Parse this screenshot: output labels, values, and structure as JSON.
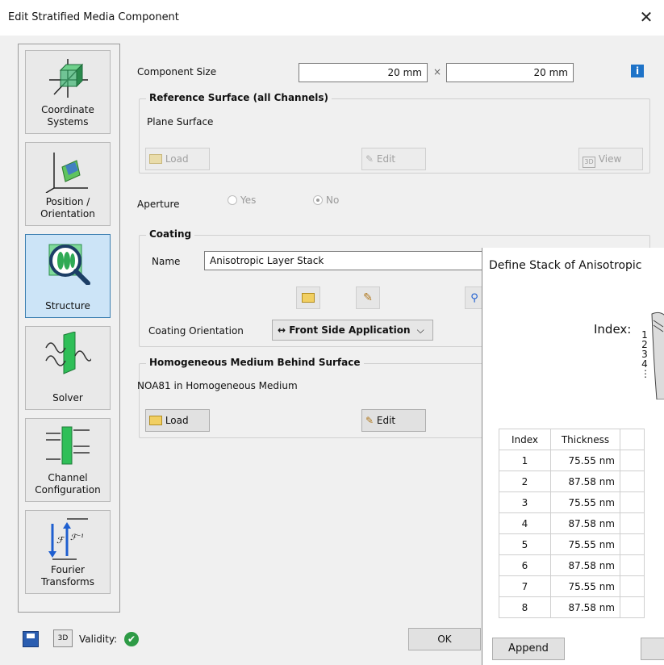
{
  "window": {
    "title": "Edit Stratified Media Component",
    "close_glyph": "✕"
  },
  "sidebar": {
    "items": [
      {
        "label_line1": "Coordinate",
        "label_line2": "Systems",
        "icon": "coordinate-systems-icon"
      },
      {
        "label_line1": "Position /",
        "label_line2": "Orientation",
        "icon": "position-orientation-icon"
      },
      {
        "label_line1": "Structure",
        "label_line2": "",
        "icon": "structure-icon",
        "selected": true
      },
      {
        "label_line1": "Solver",
        "label_line2": "",
        "icon": "solver-icon"
      },
      {
        "label_line1": "Channel",
        "label_line2": "Configuration",
        "icon": "channel-configuration-icon"
      },
      {
        "label_line1": "Fourier",
        "label_line2": "Transforms",
        "icon": "fourier-transforms-icon"
      }
    ]
  },
  "component_size": {
    "label": "Component Size",
    "width_value": "20 mm",
    "times": "×",
    "height_value": "20 mm",
    "info": "i"
  },
  "reference_surface": {
    "title": "Reference Surface (all Channels)",
    "value": "Plane Surface",
    "load_label": "Load",
    "edit_label": "Edit",
    "view_label": "View"
  },
  "aperture": {
    "label": "Aperture",
    "yes_label": "Yes",
    "no_label": "No",
    "selected": "No"
  },
  "coating": {
    "title": "Coating",
    "name_label": "Name",
    "name_value": "Anisotropic Layer Stack",
    "orientation_label": "Coating Orientation",
    "orientation_value": "↔ Front Side Application",
    "orientation_caret": "⌵"
  },
  "homogeneous_medium": {
    "title": "Homogeneous Medium Behind Surface",
    "value": "NOA81 in Homogeneous Medium",
    "load_label": "Load",
    "edit_label": "Edit"
  },
  "bottom": {
    "validity_label": "Validity:",
    "ok_label": "OK"
  },
  "child_dialog": {
    "title": "Define Stack of Anisotropic",
    "index_label": "Index:",
    "index_numbers": [
      "1",
      "2",
      "3",
      "4",
      "⋮"
    ],
    "table": {
      "headers": [
        "Index",
        "Thickness"
      ],
      "rows": [
        {
          "index": "1",
          "thickness": "75.55 nm"
        },
        {
          "index": "2",
          "thickness": "87.58 nm"
        },
        {
          "index": "3",
          "thickness": "75.55 nm"
        },
        {
          "index": "4",
          "thickness": "87.58 nm"
        },
        {
          "index": "5",
          "thickness": "75.55 nm"
        },
        {
          "index": "6",
          "thickness": "87.58 nm"
        },
        {
          "index": "7",
          "thickness": "75.55 nm"
        },
        {
          "index": "8",
          "thickness": "87.58 nm"
        }
      ]
    },
    "append_label": "Append"
  },
  "colors": {
    "selected_bg": "#cce4f7",
    "accent_blue": "#1e73c8",
    "valid_green": "#2e9b46"
  }
}
